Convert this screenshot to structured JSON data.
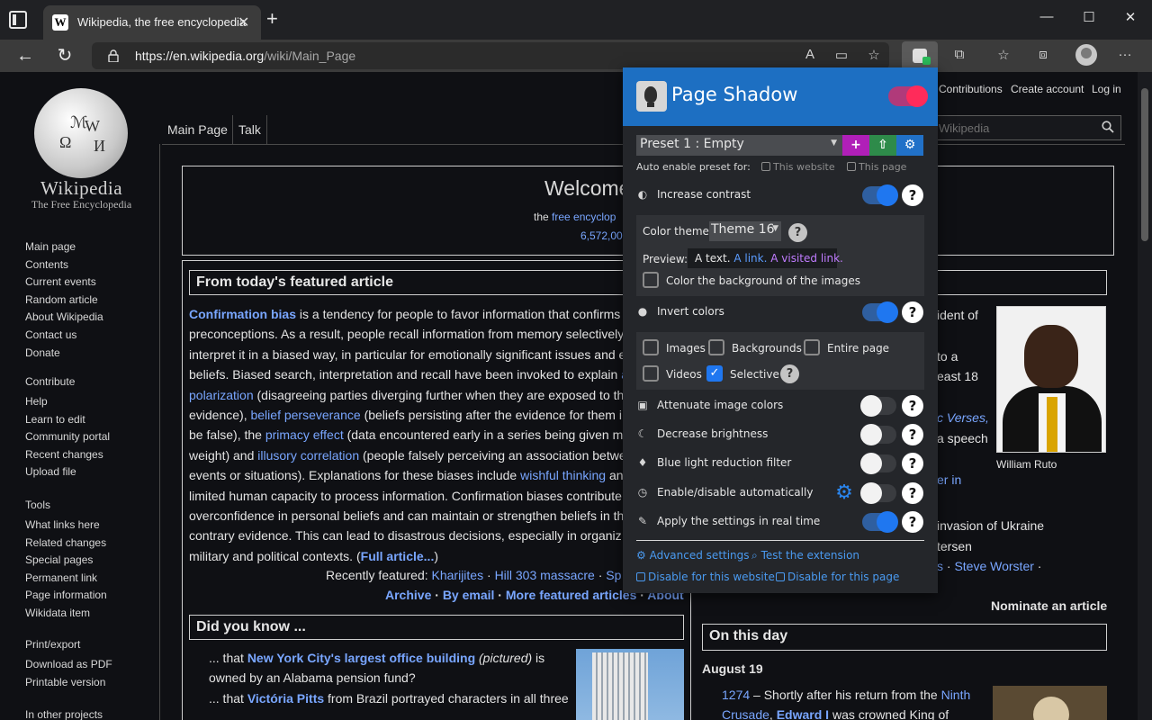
{
  "browser": {
    "tab_favicon": "W",
    "tab_title": "Wikipedia, the free encyclopedia",
    "url_domain": "https://en.wikipedia.org",
    "url_path": "/wiki/Main_Page"
  },
  "wiki": {
    "logo_word": "Wikipedia",
    "logo_tagline": "The Free Encyclopedia",
    "nav": [
      "Main page",
      "Contents",
      "Current events",
      "Random article",
      "About Wikipedia",
      "Contact us",
      "Donate"
    ],
    "contribute_head": "Contribute",
    "contribute": [
      "Help",
      "Learn to edit",
      "Community portal",
      "Recent changes",
      "Upload file"
    ],
    "tools_head": "Tools",
    "tools": [
      "What links here",
      "Related changes",
      "Special pages",
      "Permanent link",
      "Page information",
      "Wikidata item"
    ],
    "print_head": "Print/export",
    "print": [
      "Download as PDF",
      "Printable version"
    ],
    "other_head": "In other projects",
    "tabs": [
      "Main Page",
      "Talk"
    ],
    "top_links": [
      "Contributions",
      "Create account",
      "Log in"
    ],
    "search_placeholder": "Wikipedia",
    "welcome_title": "Welcome",
    "welcome_line1_prefix": "the",
    "welcome_line1_link": "free encyclop",
    "welcome_count": "6,572,00",
    "featured_head": "From today's featured article",
    "recently_featured_label": "Recently featured:",
    "recently_featured": [
      "Kharijites",
      "Hill 303 massacre",
      "Sp"
    ],
    "archive_links": [
      "Archive",
      "By email",
      "More featured articles",
      "About"
    ],
    "dyk_head": "Did you know ...",
    "right_frag": {
      "r1": "ident of",
      "r2": "to a",
      "r3": "east 18",
      "r4": "c Verses,",
      "r5": "a speech",
      "r6": "er in",
      "r7": "invasion of Ukraine",
      "r8": "tersen",
      "r9": "s",
      "r9b": "Steve Worster",
      "nominate": "Nominate an article"
    },
    "ruto_caption": "William Ruto",
    "otd_head": "On this day",
    "otd_date": "August 19",
    "otd_year": "1274",
    "otd_text1": "– Shortly after his return from the",
    "otd_link1": "Ninth",
    "otd_link2": "Crusade",
    "otd_link3": "Edward I",
    "otd_text2": "was crowned King of"
  },
  "article": {
    "link_confirmation": "Confirmation bias",
    "t1": "is a tendency for people to favor information that confirms",
    "l2": "preconceptions. As a result, people recall information from memory selectively",
    "l3": "interpret it in a biased way, in particular for emotionally significant issues and e",
    "l4a": "beliefs. Biased search, interpretation and recall have been invoked to explain",
    "l4b": "a",
    "l5_link": "polarization",
    "l5_text": "(disagreeing parties diverging further when they are exposed to th",
    "l6_text_a": "evidence),",
    "l6_link": "belief perseverance",
    "l6_text_b": "(beliefs persisting after the evidence for them i",
    "l7_text_a": "be false), the",
    "l7_link": "primacy effect",
    "l7_text_b": "(data encountered early in a series being given m",
    "l8_text_a": "weight) and",
    "l8_link": "illusory correlation",
    "l8_text_b": "(people falsely perceiving an association betwe",
    "l9_text_a": "events or situations). Explanations for these biases include",
    "l9_link": "wishful thinking",
    "l9_text_b": "an",
    "l10": "limited human capacity to process information. Confirmation biases contribute",
    "l11": "overconfidence in personal beliefs and can maintain or strengthen beliefs in th",
    "l12": "contrary evidence. This can lead to disastrous decisions, especially in organiz",
    "l13_text": "military and political contexts. (",
    "l13_link": "Full article...",
    "l13_end": ")"
  },
  "dyk": {
    "d1_prefix": "... that",
    "d1_link": "New York City's largest office building",
    "d1_italic": "(pictured)",
    "d1_suffix": "is",
    "d2": "owned by an Alabama pension fund?",
    "d3_prefix": "... that",
    "d3_link": "Victória Pitts",
    "d3_suffix": "from Brazil portrayed characters in all three"
  },
  "pageshadow": {
    "title": "Page Shadow",
    "preset": "Preset 1 : Empty",
    "btn_add": "+",
    "btn_upload": "⇧",
    "btn_settings": "⚙",
    "auto_label": "Auto enable preset for:",
    "auto_website": "This website",
    "auto_page": "This page",
    "increase_contrast": "Increase contrast",
    "color_theme_label": "Color theme:",
    "color_theme_value": "Theme 16",
    "preview_label": "Preview:",
    "preview_text": "A text.",
    "preview_link": "A link.",
    "preview_visited": "A visited link.",
    "color_bg_images": "Color the background of the images",
    "invert_colors": "Invert colors",
    "invert_images": "Images",
    "invert_backgrounds": "Backgrounds",
    "invert_entire": "Entire page",
    "invert_videos": "Videos",
    "invert_selective": "Selective",
    "attenuate": "Attenuate image colors",
    "decrease_brightness": "Decrease brightness",
    "blue_light": "Blue light reduction filter",
    "auto_enable": "Enable/disable automatically",
    "realtime": "Apply the settings in real time",
    "advanced": "Advanced settings",
    "test": "Test the extension",
    "disable_website": "Disable for this website",
    "disable_page": "Disable for this page",
    "help": "?",
    "colors": {
      "header": "#1d6fc2",
      "toggle_on": "#1f77f0",
      "master": "#ff2b5a",
      "link": "#4a9af0"
    }
  },
  "colors": {
    "wiki_link": "#79a6ff",
    "preview_link": "#5b9cff",
    "preview_visited": "#c07cff"
  }
}
